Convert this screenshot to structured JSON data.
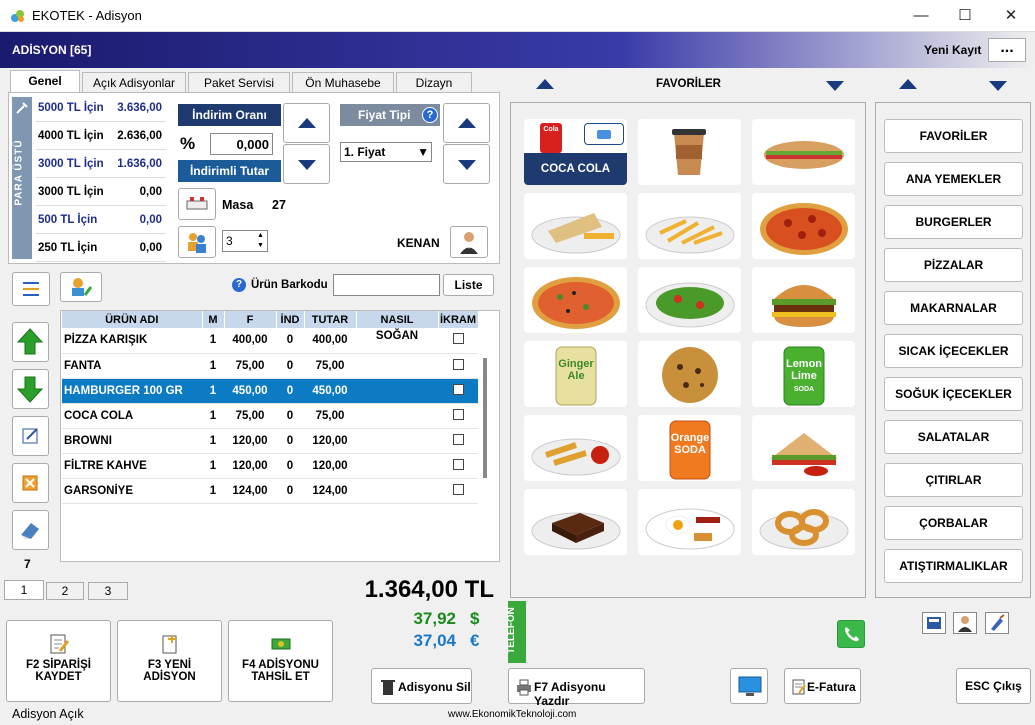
{
  "window": {
    "title": "EKOTEK - Adisyon"
  },
  "header": {
    "title": "ADİSYON [65]",
    "new_record": "Yeni Kayıt",
    "more": "..."
  },
  "tabs": [
    "Genel",
    "Açık Adisyonlar",
    "Paket Servisi",
    "Ön Muhasebe",
    "Dizayn"
  ],
  "change_panel": {
    "label": "PARA ÜSTÜ",
    "rows": [
      {
        "label": "5000 TL İçin",
        "value": "3.636,00",
        "highlight": true
      },
      {
        "label": "4000 TL İçin",
        "value": "2.636,00",
        "highlight": false
      },
      {
        "label": "3000 TL İçin",
        "value": "1.636,00",
        "highlight": true
      },
      {
        "label": "3000 TL İçin",
        "value": "0,00",
        "highlight": false
      },
      {
        "label": "500 TL İçin",
        "value": "0,00",
        "highlight": true
      },
      {
        "label": "250 TL İçin",
        "value": "0,00",
        "highlight": false
      }
    ]
  },
  "discount": {
    "rate_label": "İndirim Oranı",
    "percent_symbol": "%",
    "rate_value": "0,000",
    "discounted_label": "İndirimli Tutar"
  },
  "price_type": {
    "label": "Fiyat Tipi",
    "selected": "1. Fiyat"
  },
  "table_info": {
    "label": "Masa",
    "number": "27",
    "guests": "3",
    "waiter": "KENAN"
  },
  "barcode": {
    "label": "Ürün Barkodu",
    "value": "",
    "list_button": "Liste"
  },
  "order_table": {
    "headers": [
      "ÜRÜN ADI",
      "M",
      "F",
      "İND",
      "TUTAR",
      "NASIL",
      "İKRAM"
    ],
    "rows": [
      {
        "name": "PİZZA KARIŞIK",
        "m": "1",
        "f": "400,00",
        "ind": "0",
        "tutar": "400,00",
        "nasil": "SOĞAN",
        "selected": false
      },
      {
        "name": "FANTA",
        "m": "1",
        "f": "75,00",
        "ind": "0",
        "tutar": "75,00",
        "nasil": "",
        "selected": false
      },
      {
        "name": "HAMBURGER 100 GR",
        "m": "1",
        "f": "450,00",
        "ind": "0",
        "tutar": "450,00",
        "nasil": "",
        "selected": true
      },
      {
        "name": "COCA COLA",
        "m": "1",
        "f": "75,00",
        "ind": "0",
        "tutar": "75,00",
        "nasil": "",
        "selected": false
      },
      {
        "name": "BROWNI",
        "m": "1",
        "f": "120,00",
        "ind": "0",
        "tutar": "120,00",
        "nasil": "",
        "selected": false
      },
      {
        "name": "FİLTRE KAHVE",
        "m": "1",
        "f": "120,00",
        "ind": "0",
        "tutar": "120,00",
        "nasil": "",
        "selected": false
      },
      {
        "name": "GARSONİYE",
        "m": "1",
        "f": "124,00",
        "ind": "0",
        "tutar": "124,00",
        "nasil": "",
        "selected": false
      }
    ]
  },
  "item_count": "7",
  "page_tabs": [
    "1",
    "2",
    "3"
  ],
  "totals": {
    "tl": "1.364,00 TL",
    "usd": "37,92",
    "usd_symbol": "$",
    "eur": "37,04",
    "eur_symbol": "€"
  },
  "telefon": "TELEFON",
  "favorites_label": "FAVORİLER",
  "products": [
    {
      "name": "COCA COLA",
      "icon": "cola-can",
      "selected": true,
      "badge": "Cola"
    },
    {
      "name": "FİLTRE KAHVE",
      "icon": "coffee-cup"
    },
    {
      "name": "SANDVİÇ",
      "icon": "sub-sandwich"
    },
    {
      "name": "WRAP",
      "icon": "wrap-plate"
    },
    {
      "name": "PATATES",
      "icon": "fries-plate"
    },
    {
      "name": "PİZZA",
      "icon": "pizza"
    },
    {
      "name": "PİZZA KARIŞIK",
      "icon": "pizza-mixed"
    },
    {
      "name": "SALATA",
      "icon": "salad"
    },
    {
      "name": "HAMBURGER",
      "icon": "burger"
    },
    {
      "name": "GINGER ALE",
      "icon": "ginger-can",
      "can_text": [
        "Ginger",
        "Ale"
      ]
    },
    {
      "name": "KURABİYE",
      "icon": "cookie"
    },
    {
      "name": "LEMON LIME",
      "icon": "lemon-can",
      "can_text": [
        "Lemon",
        "Lime",
        "SODA"
      ]
    },
    {
      "name": "MOZARELLA",
      "icon": "sticks-plate"
    },
    {
      "name": "ORANGE",
      "icon": "orange-can",
      "can_text": [
        "Orange",
        "SODA"
      ]
    },
    {
      "name": "KULÜP SANDVİÇ",
      "icon": "club-sandwich"
    },
    {
      "name": "BROWNI",
      "icon": "brownie"
    },
    {
      "name": "KAHVALTI",
      "icon": "breakfast"
    },
    {
      "name": "SOĞAN HALKASI",
      "icon": "onion-rings"
    }
  ],
  "categories": [
    "FAVORİLER",
    "ANA YEMEKLER",
    "BURGERLER",
    "PİZZALAR",
    "MAKARNALAR",
    "SICAK İÇECEKLER",
    "SOĞUK İÇECEKLER",
    "SALATALAR",
    "ÇITIRLAR",
    "ÇORBALAR",
    "ATIŞTIRMALIKLAR"
  ],
  "actions": {
    "f2": "F2 SİPARİŞİ KAYDET",
    "f3": "F3 YENİ ADİSYON",
    "f4": "F4 ADİSYONU TAHSİL ET",
    "delete": "Adisyonu Sil",
    "print": "F7 Adisyonu Yazdır",
    "efatura": "E-Fatura",
    "exit": "ESC Çıkış"
  },
  "status": {
    "text": "Adisyon Açık",
    "website": "www.EkonomikTeknoloji.com"
  },
  "colors": {
    "header": "#1a1a6e",
    "selected_row": "#0d7ac4",
    "usd": "#1a8a1a",
    "eur": "#1a78c8",
    "telefon": "#3aa83a"
  }
}
